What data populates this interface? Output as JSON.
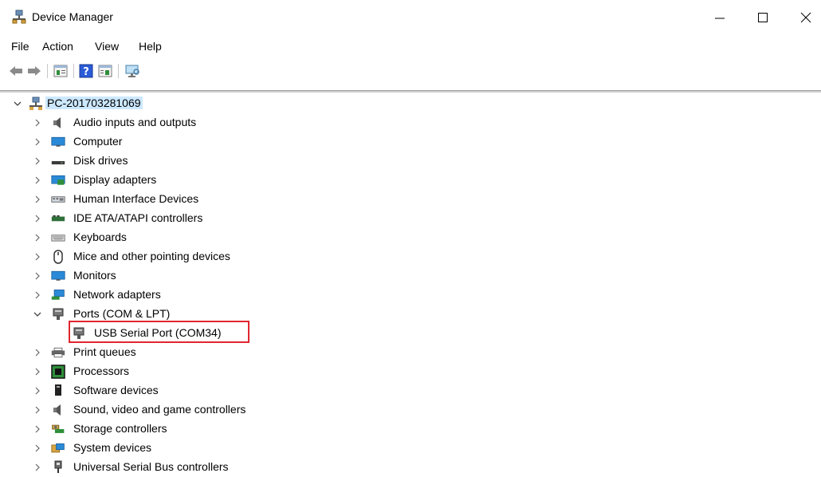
{
  "window": {
    "title": "Device Manager",
    "app_icon": "device-manager-icon",
    "controls": [
      "minimize-icon",
      "maximize-icon",
      "close-icon"
    ]
  },
  "menu": {
    "file": "File",
    "action": "Action",
    "view": "View",
    "help": "Help"
  },
  "toolbar": {
    "buttons": [
      "back-icon",
      "forward-icon",
      "properties-icon",
      "help-icon",
      "update-driver-icon",
      "scan-hardware-icon"
    ]
  },
  "tree": {
    "root": "PC-201703281069",
    "categories": {
      "audio": "Audio inputs and outputs",
      "computer": "Computer",
      "disk": "Disk drives",
      "display": "Display adapters",
      "hid": "Human Interface Devices",
      "ide": "IDE ATA/ATAPI controllers",
      "keyboards": "Keyboards",
      "mice": "Mice and other pointing devices",
      "monitors": "Monitors",
      "network": "Network adapters",
      "ports": "Ports (COM & LPT)",
      "ports_child": "USB Serial Port (COM34)",
      "print": "Print queues",
      "processors": "Processors",
      "software": "Software devices",
      "sound": "Sound, video and game controllers",
      "storage": "Storage controllers",
      "system": "System devices",
      "usb": "Universal Serial Bus controllers"
    }
  },
  "colors": {
    "selection": "#cce8ff",
    "highlight_box": "#e0262f"
  }
}
